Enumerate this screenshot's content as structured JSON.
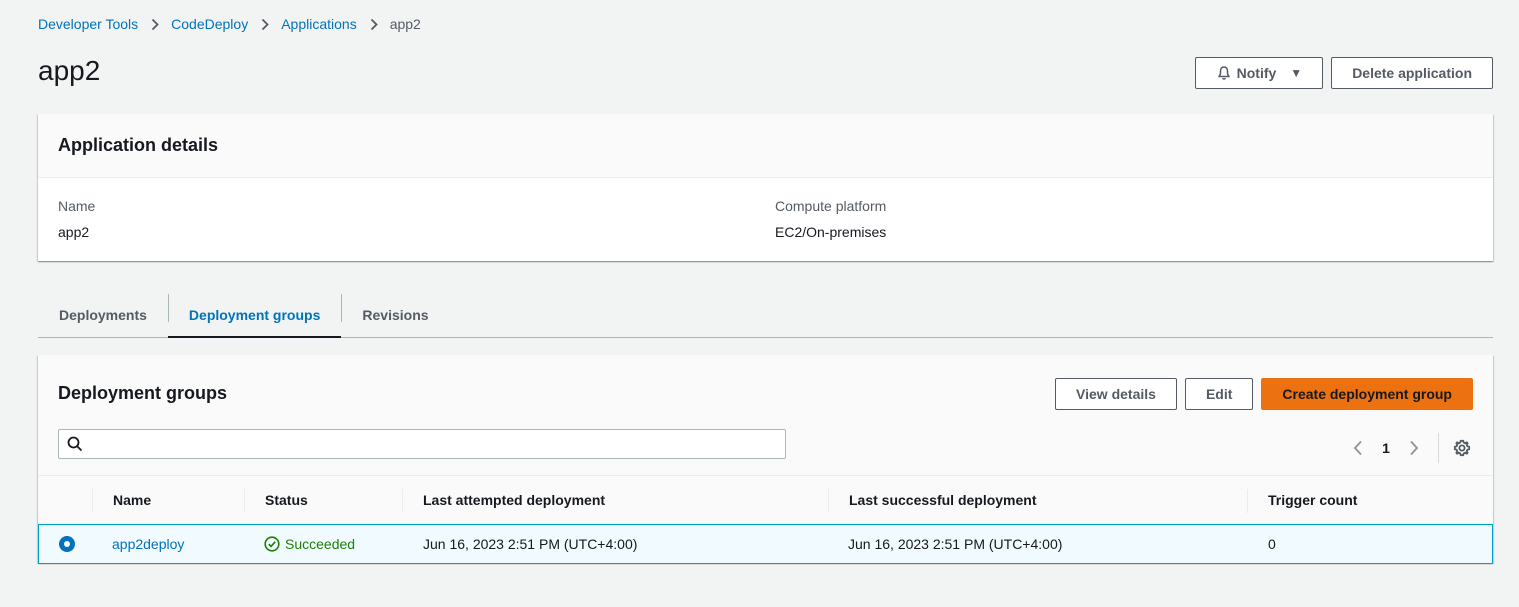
{
  "breadcrumb": {
    "items": [
      "Developer Tools",
      "CodeDeploy",
      "Applications"
    ],
    "current": "app2"
  },
  "page": {
    "title": "app2",
    "notify_label": "Notify",
    "delete_label": "Delete application"
  },
  "details": {
    "title": "Application details",
    "name_label": "Name",
    "name_value": "app2",
    "platform_label": "Compute platform",
    "platform_value": "EC2/On-premises"
  },
  "tabs": [
    {
      "label": "Deployments",
      "active": false
    },
    {
      "label": "Deployment groups",
      "active": true
    },
    {
      "label": "Revisions",
      "active": false
    }
  ],
  "groups": {
    "title": "Deployment groups",
    "view_details_label": "View details",
    "edit_label": "Edit",
    "create_label": "Create deployment group",
    "search_placeholder": "",
    "page_number": "1",
    "columns": [
      "Name",
      "Status",
      "Last attempted deployment",
      "Last successful deployment",
      "Trigger count"
    ],
    "rows": [
      {
        "name": "app2deploy",
        "status": "Succeeded",
        "last_attempted": "Jun 16, 2023 2:51 PM (UTC+4:00)",
        "last_successful": "Jun 16, 2023 2:51 PM (UTC+4:00)",
        "trigger_count": "0",
        "selected": true
      }
    ]
  },
  "colors": {
    "link": "#0073bb",
    "primary": "#ec7211",
    "success": "#1d8102",
    "selected_row_bg": "#f1faff",
    "selected_row_border": "#00a1c9"
  },
  "icons": [
    "chevron-right-icon",
    "bell-icon",
    "caret-down-icon",
    "search-icon",
    "chevron-left-icon",
    "gear-icon",
    "check-circle-icon"
  ]
}
